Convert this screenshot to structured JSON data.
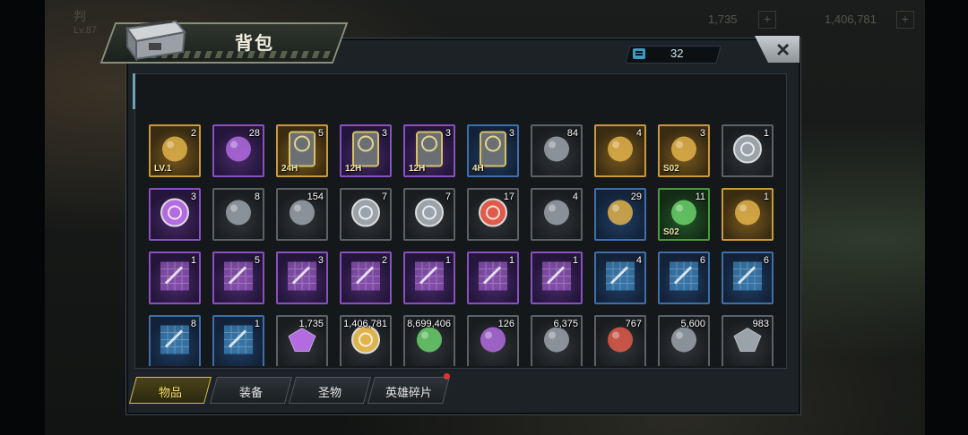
{
  "window": {
    "title": "背包"
  },
  "counter": {
    "value": "32",
    "icon": "bag-capacity-icon"
  },
  "close": {
    "label": "×"
  },
  "background_hud": {
    "player_name": "判",
    "level": "Lv.87",
    "currency_1": "1,735",
    "currency_2": "1,406,781"
  },
  "tabs": [
    {
      "label": "物品",
      "active": true
    },
    {
      "label": "装备",
      "active": false
    },
    {
      "label": "圣物",
      "active": false
    },
    {
      "label": "英雄碎片",
      "active": false,
      "has_notification": true
    }
  ],
  "items": [
    {
      "icon": "treasure-chest-icon",
      "count": "2",
      "rarity": "gold",
      "badge": "LV.1"
    },
    {
      "icon": "blue-orb-icon",
      "count": "28",
      "rarity": "purple"
    },
    {
      "icon": "gold-boost-card-icon",
      "count": "5",
      "rarity": "gold",
      "badge": "24H"
    },
    {
      "icon": "exp-boost-card-icon",
      "count": "3",
      "rarity": "purple",
      "badge": "12H"
    },
    {
      "icon": "gold-boost-card-icon",
      "count": "3",
      "rarity": "purple",
      "badge": "12H"
    },
    {
      "icon": "gold-boost-card-icon",
      "count": "3",
      "rarity": "blue",
      "badge": "4H"
    },
    {
      "icon": "candy-icon",
      "count": "84",
      "rarity": "grey"
    },
    {
      "icon": "rabbit-toy-icon",
      "count": "4",
      "rarity": "gold"
    },
    {
      "icon": "flower-bouquet-icon",
      "count": "3",
      "rarity": "gold",
      "badge": "S02"
    },
    {
      "icon": "pink-token-icon",
      "count": "1",
      "rarity": "grey"
    },
    {
      "icon": "poker-chip-icon",
      "count": "3",
      "rarity": "purple"
    },
    {
      "icon": "police-badge-icon",
      "count": "8",
      "rarity": "grey"
    },
    {
      "icon": "cinema-ticket-icon",
      "count": "154",
      "rarity": "grey"
    },
    {
      "icon": "m-coin-icon",
      "count": "7",
      "rarity": "grey"
    },
    {
      "icon": "b-coin-icon",
      "count": "7",
      "rarity": "grey"
    },
    {
      "icon": "red-chip-icon",
      "count": "17",
      "rarity": "grey"
    },
    {
      "icon": "bullet-icon",
      "count": "4",
      "rarity": "grey"
    },
    {
      "icon": "golden-key-icon",
      "count": "29",
      "rarity": "blue"
    },
    {
      "icon": "green-cap-icon",
      "count": "11",
      "rarity": "green",
      "badge": "S02"
    },
    {
      "icon": "gold-shirt-icon",
      "count": "1",
      "rarity": "gold"
    },
    {
      "icon": "purple-shirt-blueprint-icon",
      "count": "1",
      "rarity": "purple"
    },
    {
      "icon": "purple-shirt-blueprint-icon",
      "count": "5",
      "rarity": "purple"
    },
    {
      "icon": "purple-gun-blueprint-icon",
      "count": "3",
      "rarity": "purple"
    },
    {
      "icon": "purple-boots-blueprint-icon",
      "count": "2",
      "rarity": "purple"
    },
    {
      "icon": "purple-sword-blueprint-icon",
      "count": "1",
      "rarity": "purple"
    },
    {
      "icon": "purple-sword-blueprint-icon",
      "count": "1",
      "rarity": "purple"
    },
    {
      "icon": "purple-hat-blueprint-icon",
      "count": "1",
      "rarity": "purple"
    },
    {
      "icon": "blue-boots-blueprint-icon",
      "count": "4",
      "rarity": "blue"
    },
    {
      "icon": "blue-sword-blueprint-icon",
      "count": "6",
      "rarity": "blue"
    },
    {
      "icon": "blue-gun-blueprint-icon",
      "count": "6",
      "rarity": "blue"
    },
    {
      "icon": "blue-sword-blueprint-icon",
      "count": "8",
      "rarity": "blue"
    },
    {
      "icon": "blue-hat-blueprint-icon",
      "count": "1",
      "rarity": "blue"
    },
    {
      "icon": "purple-gem-icon",
      "count": "1,735",
      "rarity": "grey"
    },
    {
      "icon": "gold-coins-icon",
      "count": "1,406,781",
      "rarity": "grey"
    },
    {
      "icon": "green-potion-icon",
      "count": "8,699,406",
      "rarity": "grey"
    },
    {
      "icon": "purple-core-icon",
      "count": "126",
      "rarity": "grey"
    },
    {
      "icon": "gear-part-icon",
      "count": "6,375",
      "rarity": "grey"
    },
    {
      "icon": "red-atom-icon",
      "count": "767",
      "rarity": "grey"
    },
    {
      "icon": "skull-emblem-icon",
      "count": "5,600",
      "rarity": "grey"
    },
    {
      "icon": "crystal-shard-icon",
      "count": "983",
      "rarity": "grey"
    }
  ],
  "colors": {
    "gold": "#c89a3c",
    "purple": "#8a4fc0",
    "blue": "#3e6fa8",
    "green": "#4a9a3e",
    "grey": "#5c6166",
    "tab_active": "#d6c050",
    "notify": "#e0352e"
  }
}
